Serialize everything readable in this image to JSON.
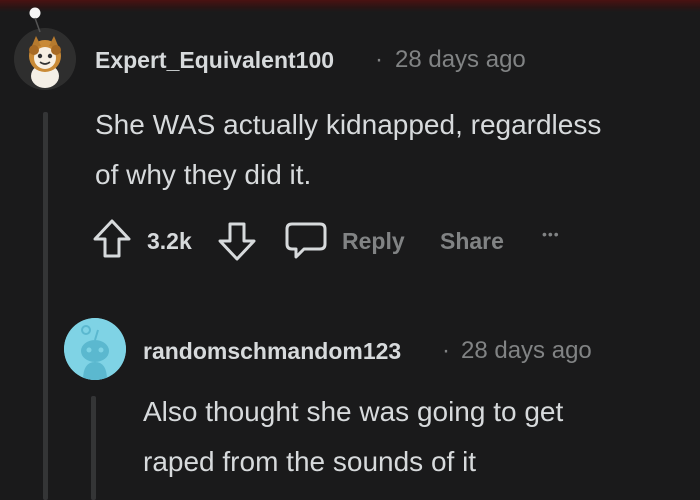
{
  "comments": [
    {
      "author": "Expert_Equivalent100",
      "separator": "·",
      "time": "28 days ago",
      "lines": [
        "She WAS actually kidnapped, regardless",
        "of why they did it."
      ],
      "score": "3.2k",
      "reply_label": "Reply",
      "share_label": "Share",
      "more_label": "•••",
      "avatar_bg": "#2e2e2e"
    },
    {
      "author": "randomschmandom123",
      "separator": "·",
      "time": "28 days ago",
      "lines": [
        "Also thought she was going to get",
        "raped from the sounds of it"
      ],
      "avatar_bg": "#7fd3e5"
    }
  ],
  "colors": {
    "background": "#1a1a1b",
    "text_primary": "#d7dadc",
    "text_secondary": "#818384",
    "thread_line": "#343536"
  },
  "icons": {
    "upvote": "arrow-up-icon",
    "downvote": "arrow-down-icon",
    "reply": "speech-bubble-icon"
  }
}
